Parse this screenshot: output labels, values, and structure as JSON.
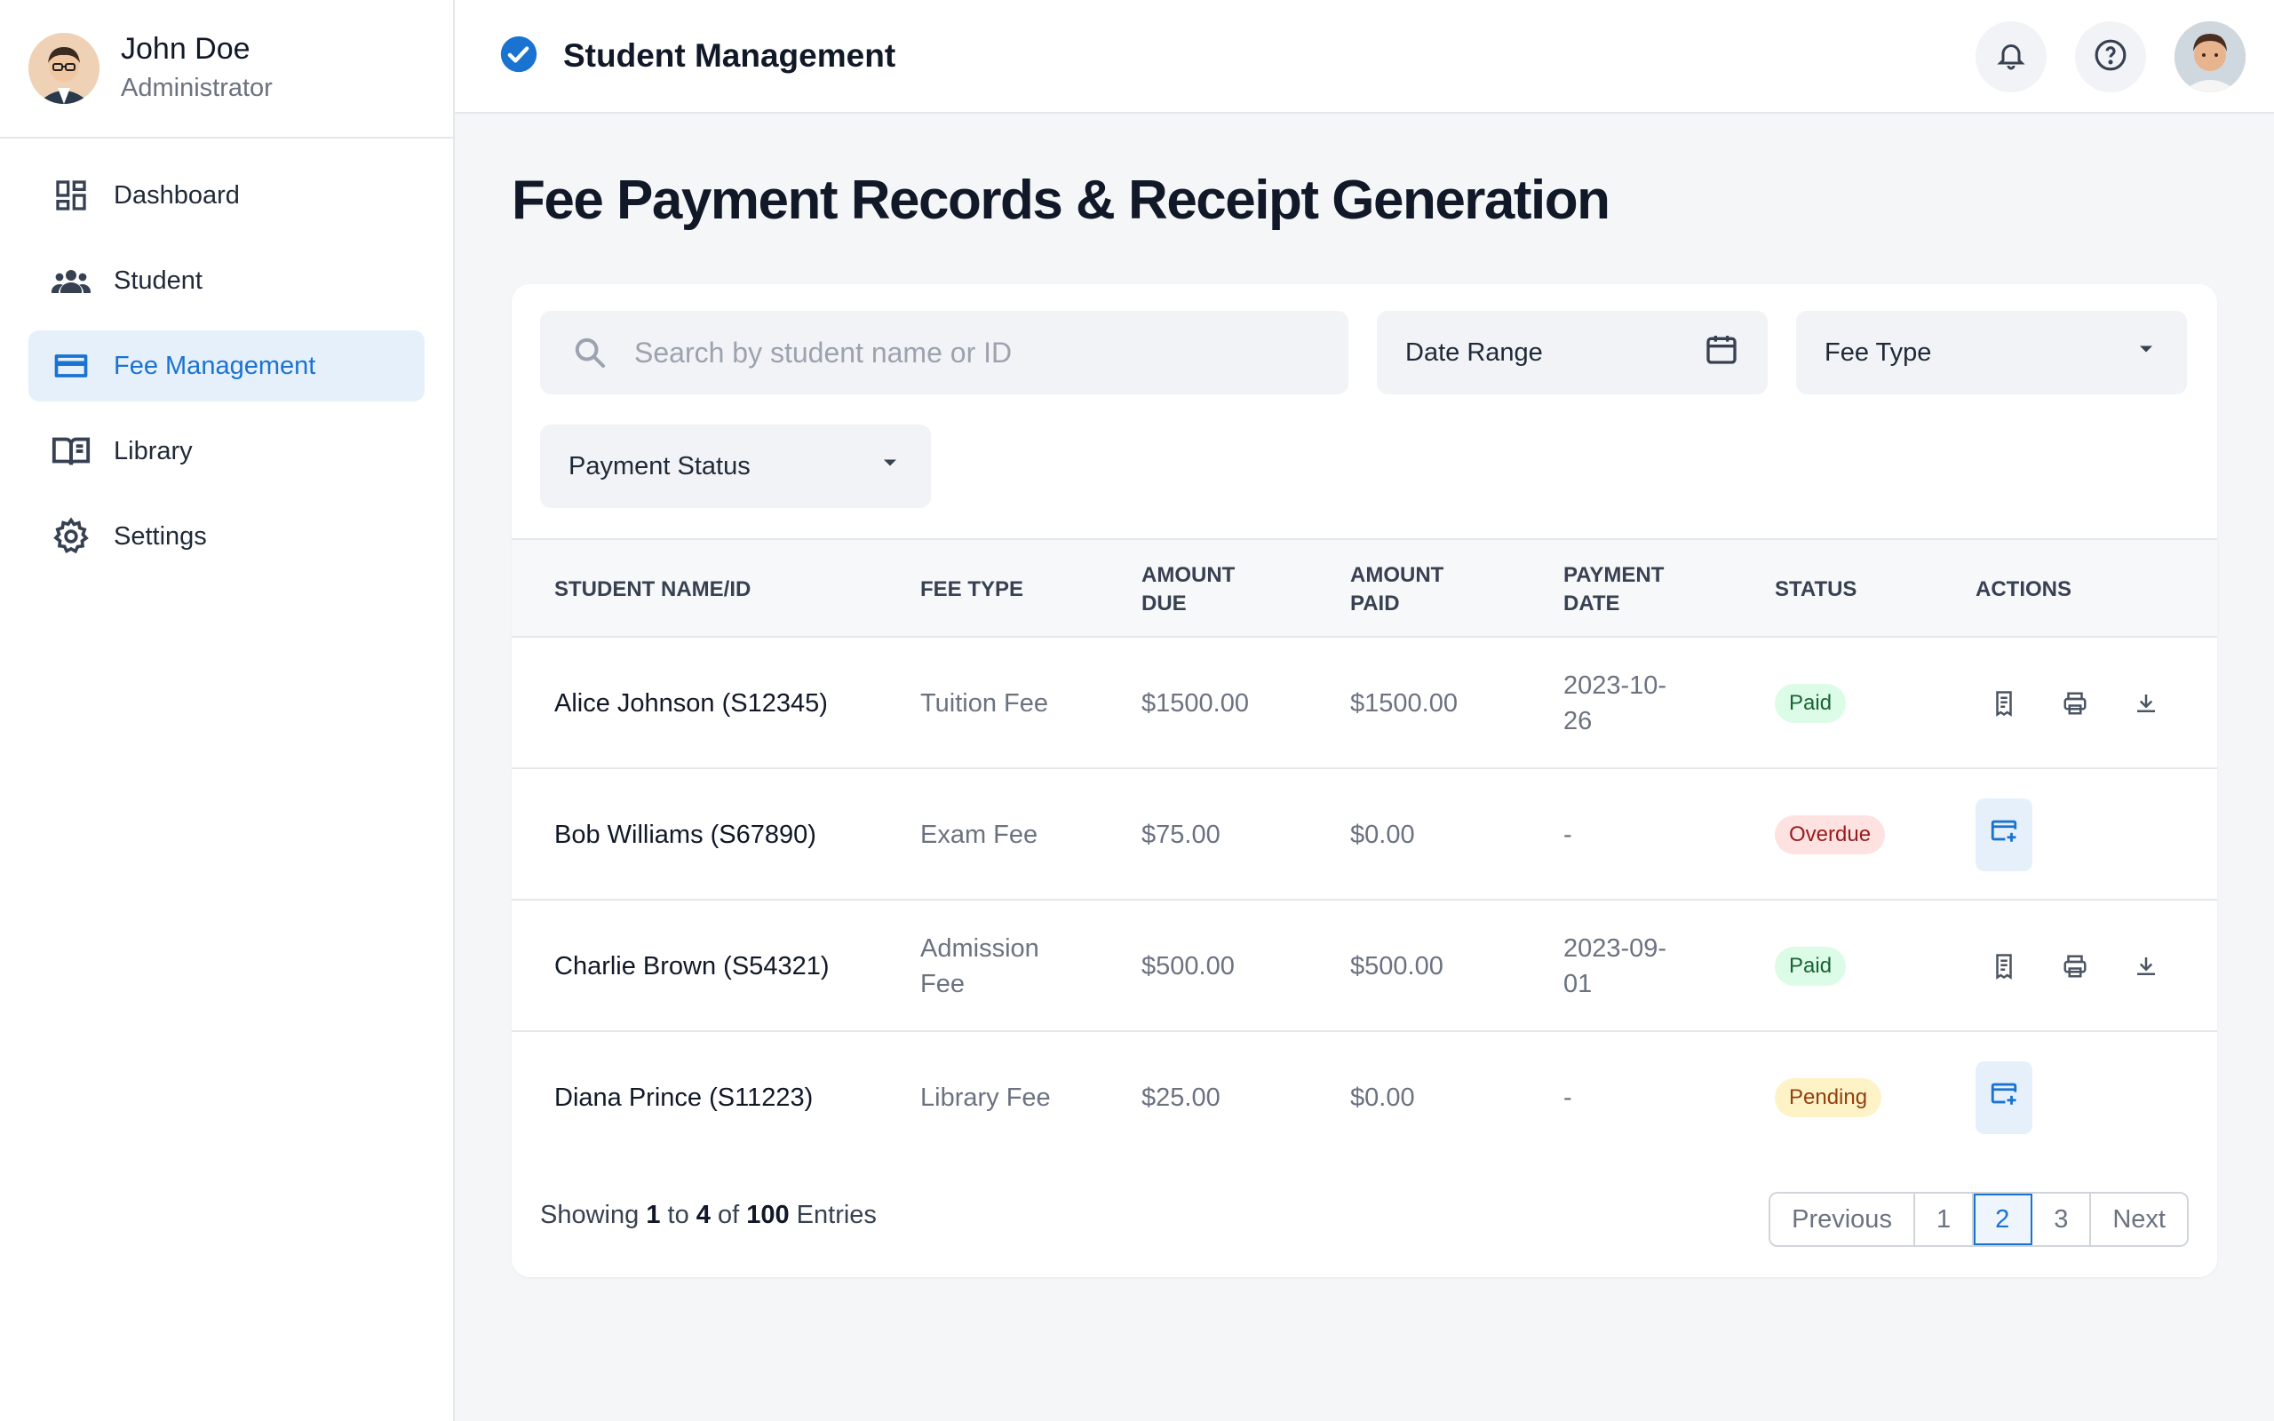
{
  "user": {
    "name": "John Doe",
    "role": "Administrator"
  },
  "sidebar": {
    "items": [
      {
        "label": "Dashboard",
        "icon": "dashboard-icon",
        "active": false
      },
      {
        "label": "Student",
        "icon": "users-icon",
        "active": false
      },
      {
        "label": "Fee Management",
        "icon": "credit-card-icon",
        "active": true
      },
      {
        "label": "Library",
        "icon": "book-icon",
        "active": false
      },
      {
        "label": "Settings",
        "icon": "gear-icon",
        "active": false
      }
    ]
  },
  "header": {
    "app_title": "Student Management",
    "logo_icon": "check-circle-icon",
    "accent": "#1a73d0"
  },
  "page": {
    "title": "Fee Payment Records & Receipt Generation"
  },
  "filters": {
    "search_placeholder": "Search by student name or ID",
    "date_range": "Date Range",
    "fee_type": "Fee Type",
    "payment_status": "Payment Status"
  },
  "table": {
    "headers": {
      "student": "STUDENT NAME/ID",
      "fee_type": "FEE TYPE",
      "amount_due_1": "AMOUNT",
      "amount_due_2": "DUE",
      "amount_paid_1": "AMOUNT",
      "amount_paid_2": "PAID",
      "payment_date_1": "PAYMENT",
      "payment_date_2": "DATE",
      "status": "STATUS",
      "actions": "ACTIONS"
    },
    "rows": [
      {
        "student": "Alice Johnson (S12345)",
        "fee_type_1": "Tuition Fee",
        "fee_type_2": "",
        "amount_due": "$1500.00",
        "amount_paid": "$1500.00",
        "date_1": "2023-10-",
        "date_2": "26",
        "status": "Paid"
      },
      {
        "student": "Bob Williams (S67890)",
        "fee_type_1": "Exam Fee",
        "fee_type_2": "",
        "amount_due": "$75.00",
        "amount_paid": "$0.00",
        "date_1": "-",
        "date_2": "",
        "status": "Overdue"
      },
      {
        "student": "Charlie Brown (S54321)",
        "fee_type_1": "Admission",
        "fee_type_2": "Fee",
        "amount_due": "$500.00",
        "amount_paid": "$500.00",
        "date_1": "2023-09-",
        "date_2": "01",
        "status": "Paid"
      },
      {
        "student": "Diana Prince (S11223)",
        "fee_type_1": "Library Fee",
        "fee_type_2": "",
        "amount_due": "$25.00",
        "amount_paid": "$0.00",
        "date_1": "-",
        "date_2": "",
        "status": "Pending"
      }
    ]
  },
  "footer": {
    "showing": "Showing",
    "from": "1",
    "to_word": "to",
    "to": "4",
    "of_word": "of",
    "total": "100",
    "entries": "Entries"
  },
  "pagination": {
    "previous": "Previous",
    "pages": [
      "1",
      "2",
      "3"
    ],
    "current": "2",
    "next": "Next"
  }
}
